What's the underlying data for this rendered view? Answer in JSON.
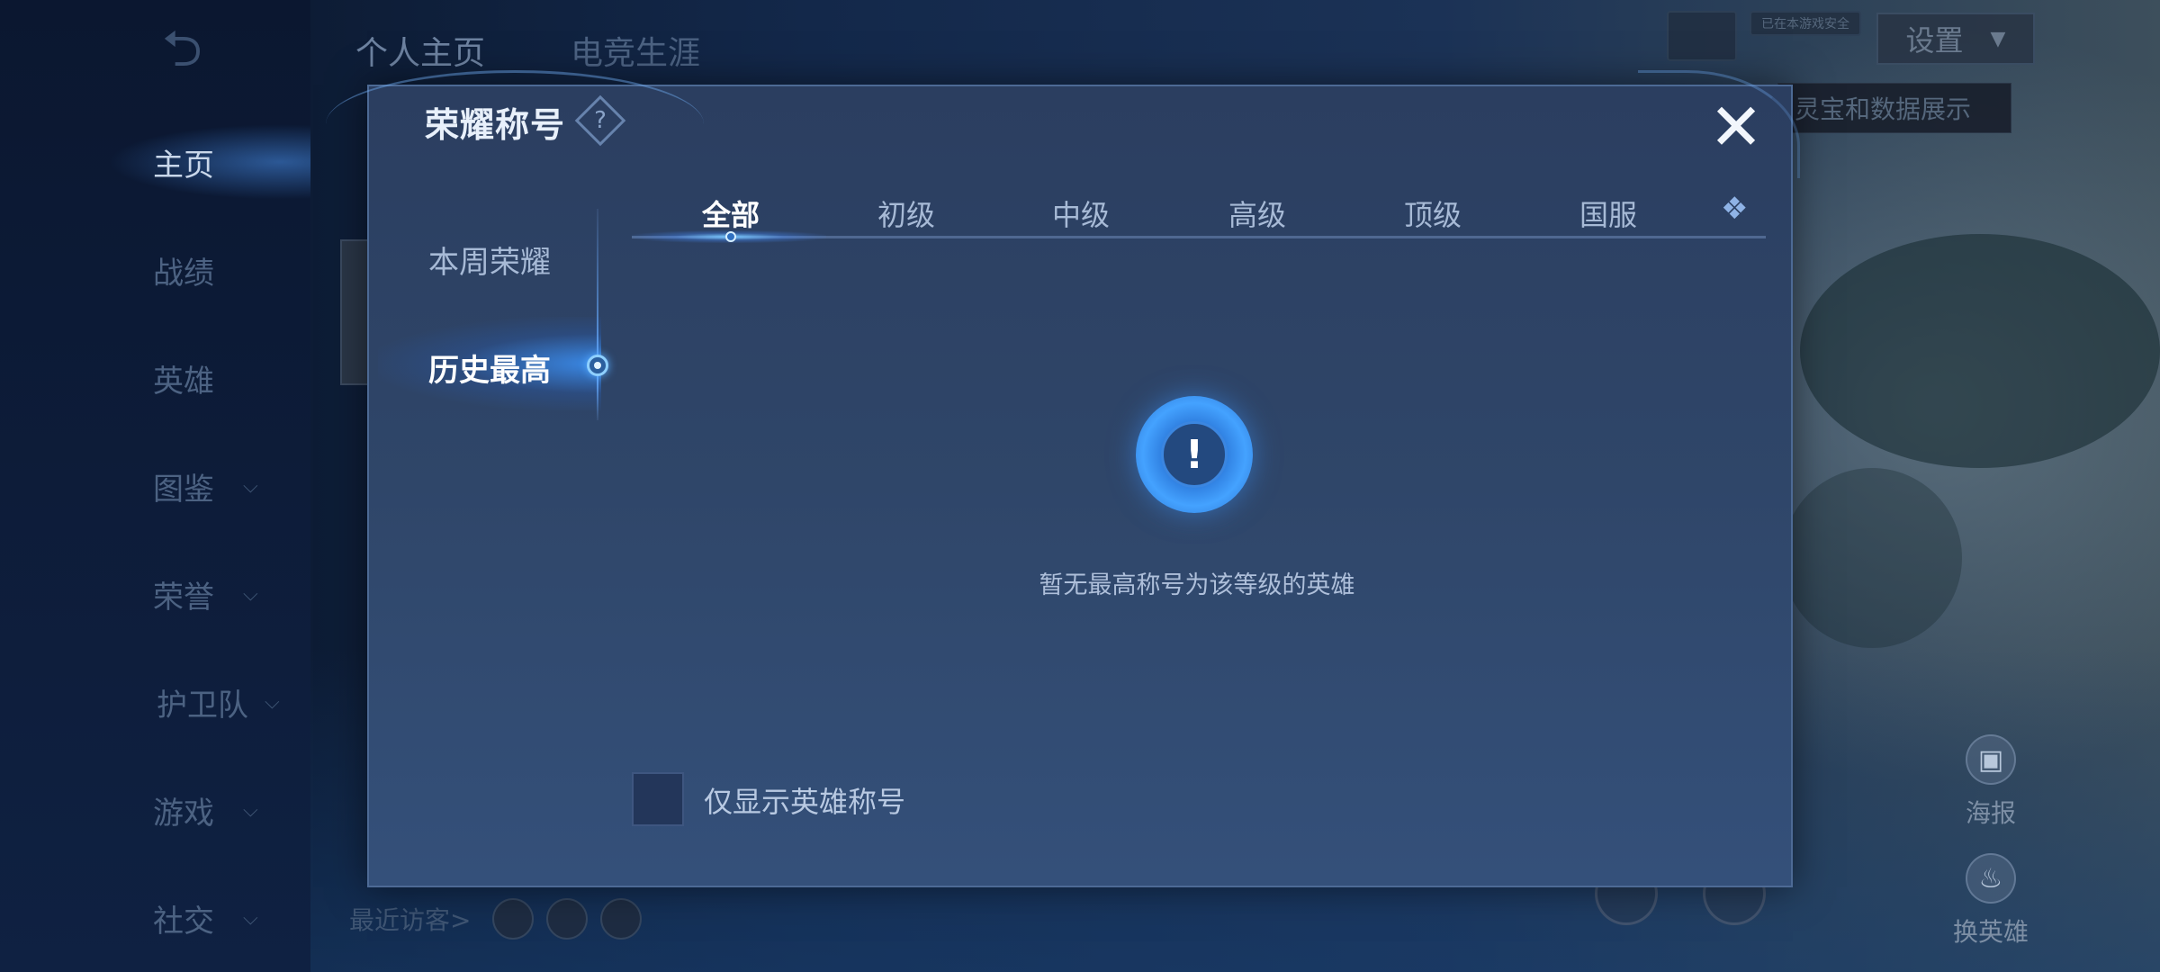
{
  "background": {
    "top_tabs": [
      {
        "label": "个人主页",
        "active": true
      },
      {
        "label": "电竞生涯",
        "active": false
      }
    ],
    "nav": [
      {
        "label": "主页",
        "active": true,
        "expandable": false
      },
      {
        "label": "战绩",
        "active": false,
        "expandable": false
      },
      {
        "label": "英雄",
        "active": false,
        "expandable": false
      },
      {
        "label": "图鉴",
        "active": false,
        "expandable": true
      },
      {
        "label": "荣誉",
        "active": false,
        "expandable": true
      },
      {
        "label": "护卫队",
        "active": false,
        "expandable": true
      },
      {
        "label": "游戏",
        "active": false,
        "expandable": true
      },
      {
        "label": "社交",
        "active": false,
        "expandable": true
      }
    ],
    "settings_label": "设置",
    "status_badge": "已在本游戏安全",
    "tooltip_text": "灵宝和数据展示",
    "visitors_label": "最近访客>",
    "right_actions": {
      "poster": "海报",
      "change_hero": "换英雄"
    }
  },
  "dialog": {
    "title": "荣耀称号",
    "help_symbol": "?",
    "close_symbol": "✕",
    "side_tabs": [
      {
        "label": "本周荣耀",
        "active": false
      },
      {
        "label": "历史最高",
        "active": true
      }
    ],
    "level_tabs": [
      {
        "label": "全部",
        "active": true
      },
      {
        "label": "初级",
        "active": false
      },
      {
        "label": "中级",
        "active": false
      },
      {
        "label": "高级",
        "active": false
      },
      {
        "label": "顶级",
        "active": false
      },
      {
        "label": "国服",
        "active": false
      }
    ],
    "empty_state": {
      "icon": "exclamation-icon",
      "text": "暂无最高称号为该等级的英雄"
    },
    "filter_checkbox": {
      "label": "仅显示英雄称号",
      "checked": false
    }
  },
  "colors": {
    "dialog_bg": "#2f4669",
    "accent_blue": "#44a2ff",
    "text_active": "#ffffff",
    "text_inactive": "#a7bad6"
  }
}
